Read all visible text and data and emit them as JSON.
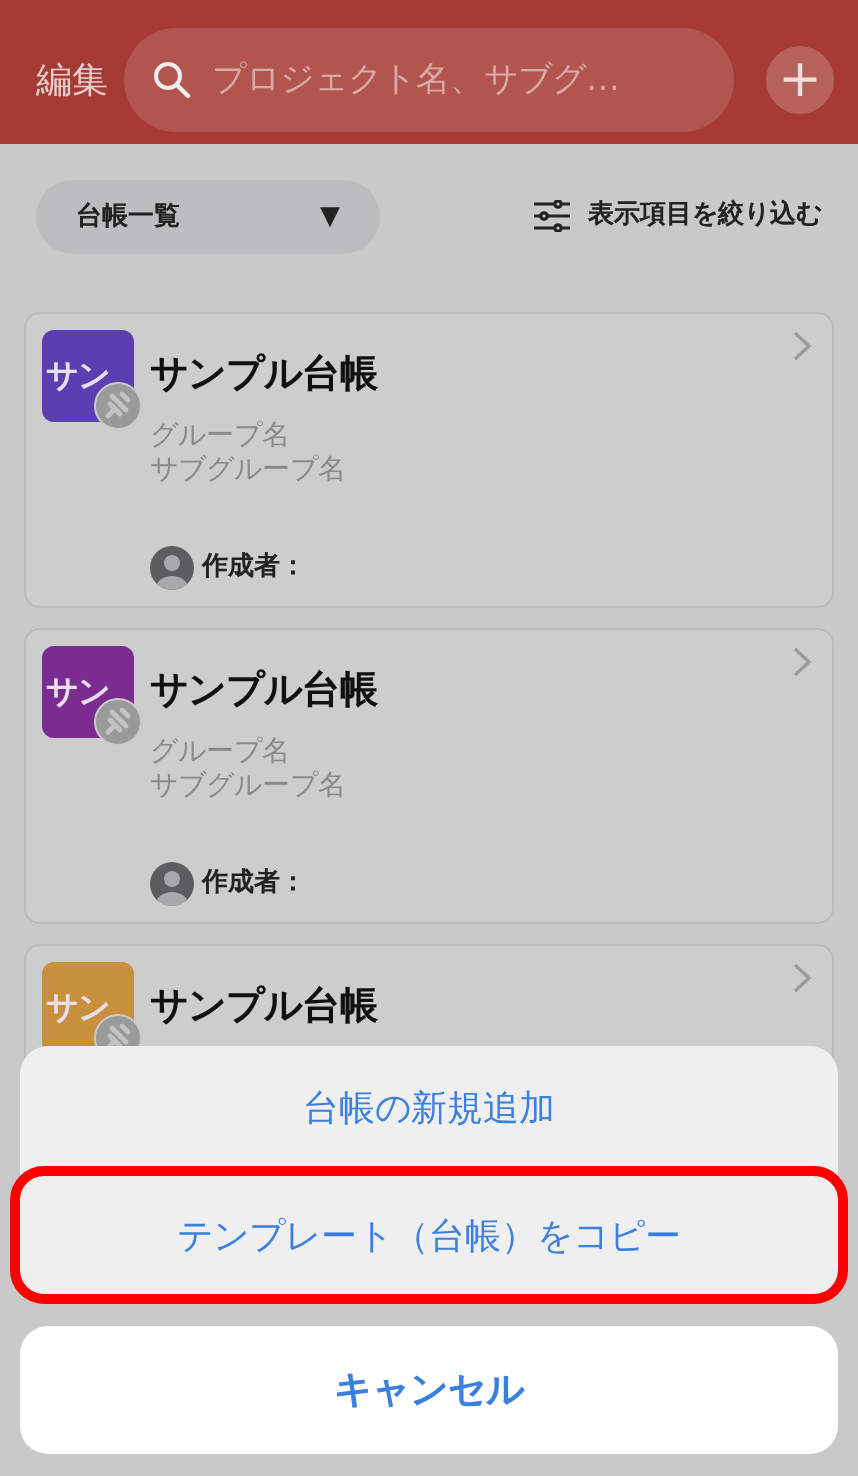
{
  "header": {
    "edit_label": "編集",
    "search": {
      "placeholder": "プロジェクト名、サブグ…"
    },
    "add_button": "+"
  },
  "toolbar": {
    "dropdown": {
      "label": "台帳一覧",
      "caret": "▼"
    },
    "filter_label": "表示項目を絞り込む"
  },
  "ledgers": [
    {
      "avatar_text": "サン",
      "color": "#5a3fb0",
      "title": "サンプル台帳",
      "group": "グループ名",
      "subgroup": "サブグループ名",
      "creator_label": "作成者："
    },
    {
      "avatar_text": "サン",
      "color": "#7a2c90",
      "title": "サンプル台帳",
      "group": "グループ名",
      "subgroup": "サブグループ名",
      "creator_label": "作成者："
    },
    {
      "avatar_text": "サン",
      "color": "#c8903c",
      "title": "サンプル台帳"
    }
  ],
  "action_sheet": {
    "items": [
      {
        "label": "台帳の新規追加",
        "highlighted": false
      },
      {
        "label": "テンプレート（台帳）をコピー",
        "highlighted": true
      }
    ],
    "cancel": "キャンセル"
  }
}
